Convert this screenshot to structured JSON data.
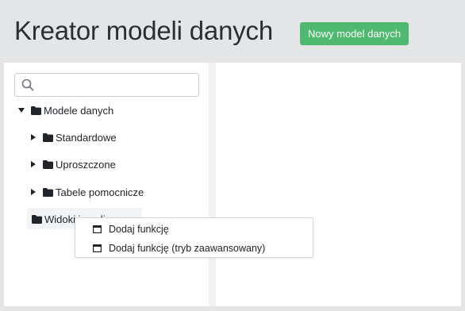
{
  "header": {
    "title": "Kreator modeli danych",
    "new_model_button": "Nowy model danych"
  },
  "colors": {
    "accent": "#4fba6f",
    "background": "#e4e5e7"
  },
  "search": {
    "value": "",
    "placeholder": "",
    "icon": "search-icon"
  },
  "tree": {
    "root": {
      "label": "Modele danych",
      "expanded": true,
      "icon": "folder-icon"
    },
    "children": [
      {
        "label": "Standardowe",
        "expanded": false
      },
      {
        "label": "Uproszczone",
        "expanded": false
      },
      {
        "label": "Tabele pomocnicze",
        "expanded": false
      }
    ],
    "views_node": {
      "label": "Widoki i analizy"
    }
  },
  "context_menu": {
    "items": [
      {
        "label": "Dodaj funkcję",
        "icon": "window-icon"
      },
      {
        "label": "Dodaj funkcję (tryb zaawansowany)",
        "icon": "window-icon"
      }
    ]
  }
}
